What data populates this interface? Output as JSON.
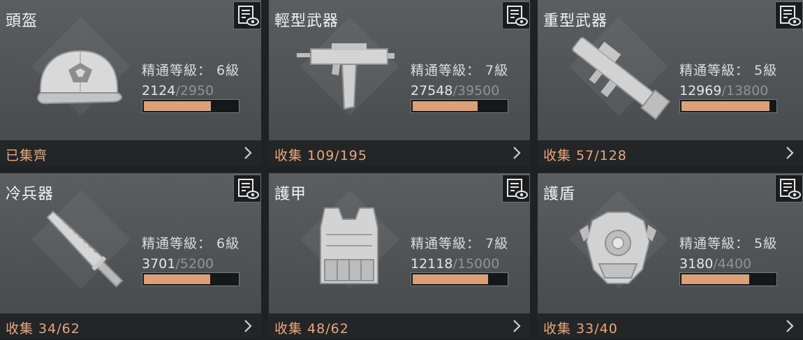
{
  "colors": {
    "card_bg": "#55585b",
    "footer_bg": "#232527",
    "accent": "#eba77d",
    "bar_fill": "#d9a079",
    "bar_track": "#15181a"
  },
  "cards": [
    {
      "title": "頭盔",
      "icon": "helmet-cap-icon",
      "mastery": "精通等級： 6級",
      "xp_current": "2124",
      "xp_sep": "/",
      "xp_max": "2950",
      "progress": 0.72,
      "collection": "已集齊"
    },
    {
      "title": "輕型武器",
      "icon": "submachine-gun-icon",
      "mastery": "精通等級： 7級",
      "xp_current": "27548",
      "xp_sep": "/",
      "xp_max": "39500",
      "progress": 0.697,
      "collection": "收集 109/195"
    },
    {
      "title": "重型武器",
      "icon": "rocket-launcher-icon",
      "mastery": "精通等級： 5級",
      "xp_current": "12969",
      "xp_sep": "/",
      "xp_max": "13800",
      "progress": 0.94,
      "collection": "收集 57/128"
    },
    {
      "title": "冷兵器",
      "icon": "machete-icon",
      "mastery": "精通等級： 6級",
      "xp_current": "3701",
      "xp_sep": "/",
      "xp_max": "5200",
      "progress": 0.712,
      "collection": "收集 34/62"
    },
    {
      "title": "護甲",
      "icon": "body-armor-icon",
      "mastery": "精通等級： 7級",
      "xp_current": "12118",
      "xp_sep": "/",
      "xp_max": "15000",
      "progress": 0.808,
      "collection": "收集 48/62"
    },
    {
      "title": "護盾",
      "icon": "shield-armor-icon",
      "mastery": "精通等級： 5級",
      "xp_current": "3180",
      "xp_sep": "/",
      "xp_max": "4400",
      "progress": 0.723,
      "collection": "收集 33/40"
    }
  ]
}
